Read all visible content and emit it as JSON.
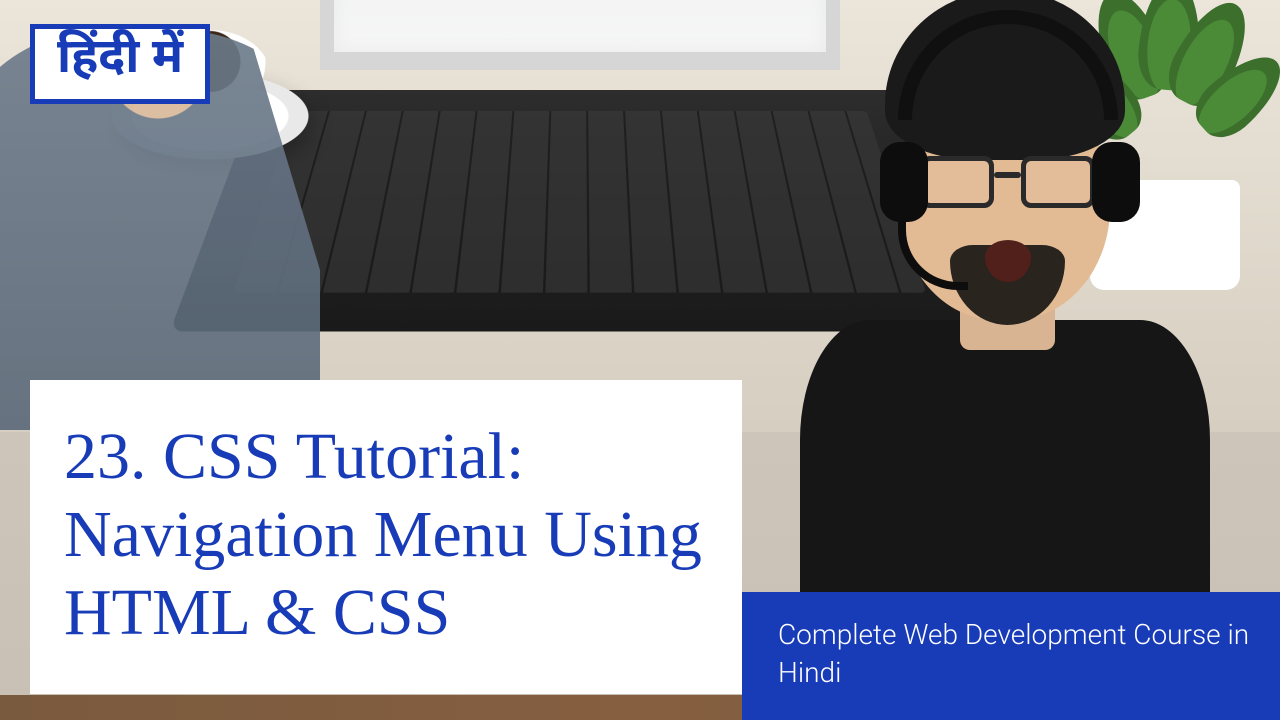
{
  "badge": {
    "hindi_label": "हिंदी में"
  },
  "title": {
    "text": "23. CSS Tutorial: Navigation Menu Using HTML & CSS"
  },
  "subtitle": {
    "text": "Complete Web Development Course in Hindi"
  },
  "colors": {
    "accent": "#183bb7"
  }
}
